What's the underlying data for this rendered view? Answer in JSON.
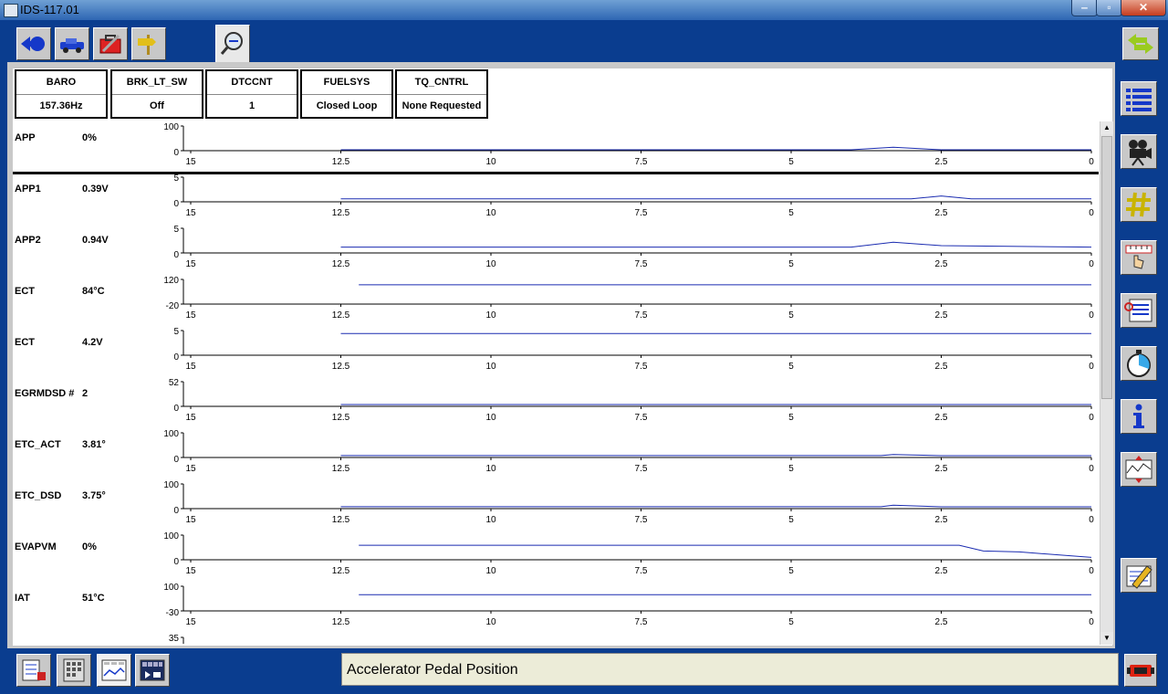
{
  "window": {
    "title": "IDS-117.01",
    "min": "‒",
    "max": "▫",
    "close": "✕"
  },
  "pids": [
    {
      "name": "BARO",
      "value": "157.36Hz"
    },
    {
      "name": "BRK_LT_SW",
      "value": "Off"
    },
    {
      "name": "DTCCNT",
      "value": "1"
    },
    {
      "name": "FUELSYS",
      "value": "Closed Loop"
    },
    {
      "name": "TQ_CNTRL",
      "value": "None Requested"
    }
  ],
  "x_ticks": [
    "15",
    "12.5",
    "10",
    "7.5",
    "5",
    "2.5",
    "0"
  ],
  "graphs": [
    {
      "label": "APP",
      "value": "0%",
      "ymax": "100",
      "ymin": "0"
    },
    {
      "label": "APP1",
      "value": "0.39V",
      "ymax": "5",
      "ymin": "0"
    },
    {
      "label": "APP2",
      "value": "0.94V",
      "ymax": "5",
      "ymin": "0"
    },
    {
      "label": "ECT",
      "value": "84°C",
      "ymax": "120",
      "ymin": "-20"
    },
    {
      "label": "ECT",
      "value": "4.2V",
      "ymax": "5",
      "ymin": "0"
    },
    {
      "label": "EGRMDSD #",
      "value": "2",
      "ymax": "52",
      "ymin": "0"
    },
    {
      "label": "ETC_ACT",
      "value": "3.81°",
      "ymax": "100",
      "ymin": "0"
    },
    {
      "label": "ETC_DSD",
      "value": "3.75°",
      "ymax": "100",
      "ymin": "0"
    },
    {
      "label": "EVAPVM",
      "value": "0%",
      "ymax": "100",
      "ymin": "0"
    },
    {
      "label": "IAT",
      "value": "51°C",
      "ymax": "100",
      "ymin": "-30"
    },
    {
      "label": "",
      "value": "",
      "ymax": "35",
      "ymin": ""
    }
  ],
  "chart_data": {
    "type": "line",
    "x_axis": {
      "from": 15,
      "to": 0,
      "ticks": [
        15,
        12.5,
        10,
        7.5,
        5,
        2.5,
        0
      ]
    },
    "series": [
      {
        "name": "APP",
        "points": [
          [
            12.5,
            0
          ],
          [
            4,
            0
          ],
          [
            3.3,
            10
          ],
          [
            2.5,
            0
          ],
          [
            0,
            0
          ]
        ]
      },
      {
        "name": "APP1",
        "points": [
          [
            12.5,
            0.4
          ],
          [
            3,
            0.4
          ],
          [
            2.5,
            1.0
          ],
          [
            2.0,
            0.4
          ],
          [
            0,
            0.4
          ]
        ]
      },
      {
        "name": "APP2",
        "points": [
          [
            12.5,
            1.0
          ],
          [
            4,
            1.0
          ],
          [
            3.3,
            2.0
          ],
          [
            2.5,
            1.3
          ],
          [
            0,
            1.0
          ]
        ]
      },
      {
        "name": "ECT",
        "points": [
          [
            12.2,
            84
          ],
          [
            0,
            84
          ]
        ]
      },
      {
        "name": "ECT",
        "points": [
          [
            12.5,
            4.2
          ],
          [
            0,
            4.2
          ]
        ]
      },
      {
        "name": "EGRMDSD #",
        "points": [
          [
            12.5,
            2
          ],
          [
            0,
            2
          ]
        ]
      },
      {
        "name": "ETC_ACT",
        "points": [
          [
            12.5,
            4
          ],
          [
            3.5,
            4
          ],
          [
            3.3,
            8
          ],
          [
            2.5,
            3.8
          ],
          [
            0,
            3.8
          ]
        ]
      },
      {
        "name": "ETC_DSD",
        "points": [
          [
            12.5,
            4
          ],
          [
            3.5,
            4
          ],
          [
            3.3,
            10
          ],
          [
            2.5,
            3.8
          ],
          [
            0,
            3.8
          ]
        ]
      },
      {
        "name": "EVAPVM",
        "points": [
          [
            12.2,
            55
          ],
          [
            2.5,
            55
          ],
          [
            2.2,
            55
          ],
          [
            1.8,
            32
          ],
          [
            1.2,
            28
          ],
          [
            0,
            6
          ]
        ]
      },
      {
        "name": "IAT",
        "points": [
          [
            12.2,
            51
          ],
          [
            0,
            51
          ]
        ]
      }
    ]
  },
  "status": {
    "text": "Accelerator Pedal Position"
  },
  "toolbar": {
    "top": [
      "back-arrow-icon",
      "vehicle-icon",
      "toolbox-icon",
      "signpost-icon",
      "datalogger-icon"
    ],
    "right": [
      "list-icon",
      "camera-icon",
      "hash-icon",
      "ruler-hand-icon",
      "notes-icon",
      "stopwatch-icon",
      "info-icon",
      "scale-graph-icon",
      "eraser-icon"
    ],
    "bottom": [
      "pid-select-icon",
      "keyboard-icon",
      "graph-view-icon",
      "playback-icon"
    ]
  },
  "colors": {
    "frame": "#0a3d8f",
    "trace": "#1a2bb0",
    "panel": "#c9c9c9"
  }
}
